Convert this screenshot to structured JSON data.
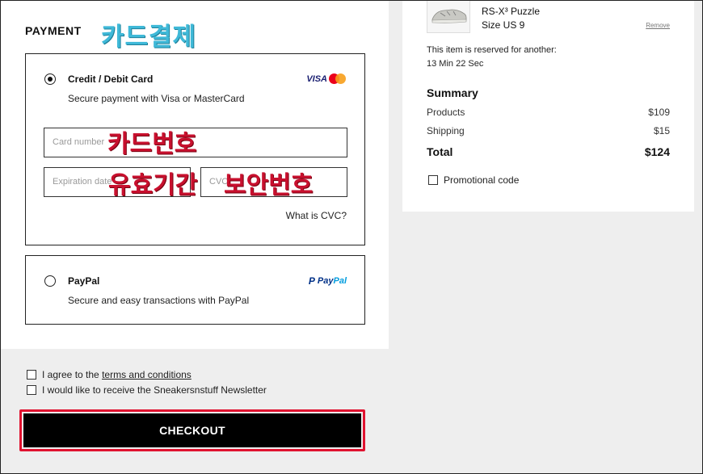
{
  "payment": {
    "title": "PAYMENT",
    "annotation_title": "카드결제",
    "card_option": {
      "label": "Credit / Debit Card",
      "description": "Secure payment with Visa or MasterCard",
      "logo_text": "VISA",
      "selected": true,
      "card_number_placeholder": "Card number",
      "expiration_placeholder": "Expiration date",
      "cvc_placeholder": "CVC",
      "cvc_link": "What is CVC?",
      "annotation_card_number": "카드번호",
      "annotation_expiration": "유효기간",
      "annotation_cvc": "보안번호"
    },
    "paypal_option": {
      "label": "PayPal",
      "description": "Secure and easy transactions with PayPal",
      "logo_p": "P",
      "logo_pay": "Pay",
      "logo_pal": "Pal",
      "selected": false
    }
  },
  "agreements": {
    "terms_prefix": "I agree to the ",
    "terms_link": "terms and conditions",
    "newsletter": "I would like to receive the Sneakersnstuff Newsletter"
  },
  "checkout_label": "CHECKOUT",
  "cart": {
    "item_name": "RS-X³ Puzzle",
    "item_size": "Size US 9",
    "remove_label": "Remove",
    "reserved_text": "This item is reserved for another:",
    "reserved_time": "13 Min 22 Sec"
  },
  "summary": {
    "title": "Summary",
    "products_label": "Products",
    "products_value": "$109",
    "shipping_label": "Shipping",
    "shipping_value": "$15",
    "total_label": "Total",
    "total_value": "$124",
    "promo_label": "Promotional code"
  },
  "colors": {
    "annotation_blue": "#3fb9d8",
    "annotation_red": "#c8102e",
    "highlight_border": "#e0122f",
    "checkout_bg": "#000000"
  }
}
